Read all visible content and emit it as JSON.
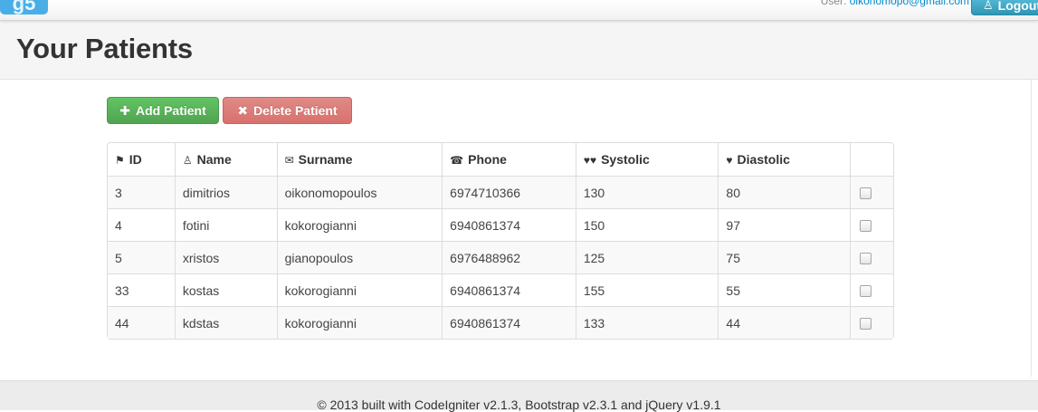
{
  "navbar": {
    "brand": "g5",
    "user_label": "User: ",
    "user_email": "oikonomopo@gmail.com",
    "logout_label": "Logout"
  },
  "header": {
    "title": "Your Patients"
  },
  "actions": {
    "add_label": "Add Patient",
    "delete_label": "Delete Patient"
  },
  "table": {
    "columns": [
      "ID",
      "Name",
      "Surname",
      "Phone",
      "Systolic",
      "Diastolic"
    ],
    "rows": [
      {
        "id": "3",
        "name": "dimitrios",
        "surname": "oikonomopoulos",
        "phone": "6974710366",
        "systolic": "130",
        "diastolic": "80"
      },
      {
        "id": "4",
        "name": "fotini",
        "surname": "kokorogianni",
        "phone": "6940861374",
        "systolic": "150",
        "diastolic": "97"
      },
      {
        "id": "5",
        "name": "xristos",
        "surname": "gianopoulos",
        "phone": "6976488962",
        "systolic": "125",
        "diastolic": "75"
      },
      {
        "id": "33",
        "name": "kostas",
        "surname": "kokorogianni",
        "phone": "6940861374",
        "systolic": "155",
        "diastolic": "55"
      },
      {
        "id": "44",
        "name": "kdstas",
        "surname": "kokorogianni",
        "phone": "6940861374",
        "systolic": "133",
        "diastolic": "44"
      }
    ]
  },
  "footer": {
    "text": "© 2013 built with CodeIgniter v2.1.3, Bootstrap v2.3.1 and jQuery v1.9.1"
  },
  "icons": {
    "id": "tags-icon",
    "name": "user-icon",
    "surname": "envelope-icon",
    "phone": "headphones-icon",
    "systolic": "hearts-icon",
    "diastolic": "heart-icon",
    "add": "plus-icon",
    "delete": "remove-icon"
  },
  "colors": {
    "add_button": "#5bb75b",
    "delete_button": "#da7470",
    "logout_button": "#49afcd",
    "link": "#0088cc"
  }
}
